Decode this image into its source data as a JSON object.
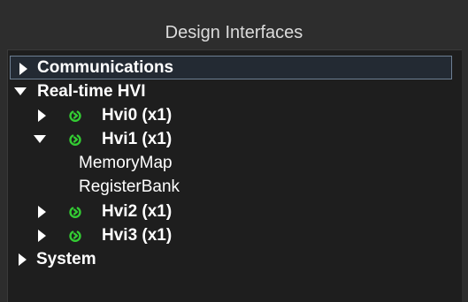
{
  "panel": {
    "title": "Design Interfaces"
  },
  "tree": {
    "communications": "Communications",
    "realtime_hvi": "Real-time HVI",
    "hvi0": "Hvi0 (x1)",
    "hvi1": "Hvi1 (x1)",
    "memory_map": "MemoryMap",
    "register_bank": "RegisterBank",
    "hvi2": "Hvi2 (x1)",
    "hvi3": "Hvi3 (x1)",
    "system": "System"
  },
  "colors": {
    "status_icon": "#33cc33",
    "selection_border": "#6d7f93"
  },
  "icons": {
    "expanded": "triangle-down",
    "collapsed": "triangle-right",
    "status": "power-icon"
  }
}
